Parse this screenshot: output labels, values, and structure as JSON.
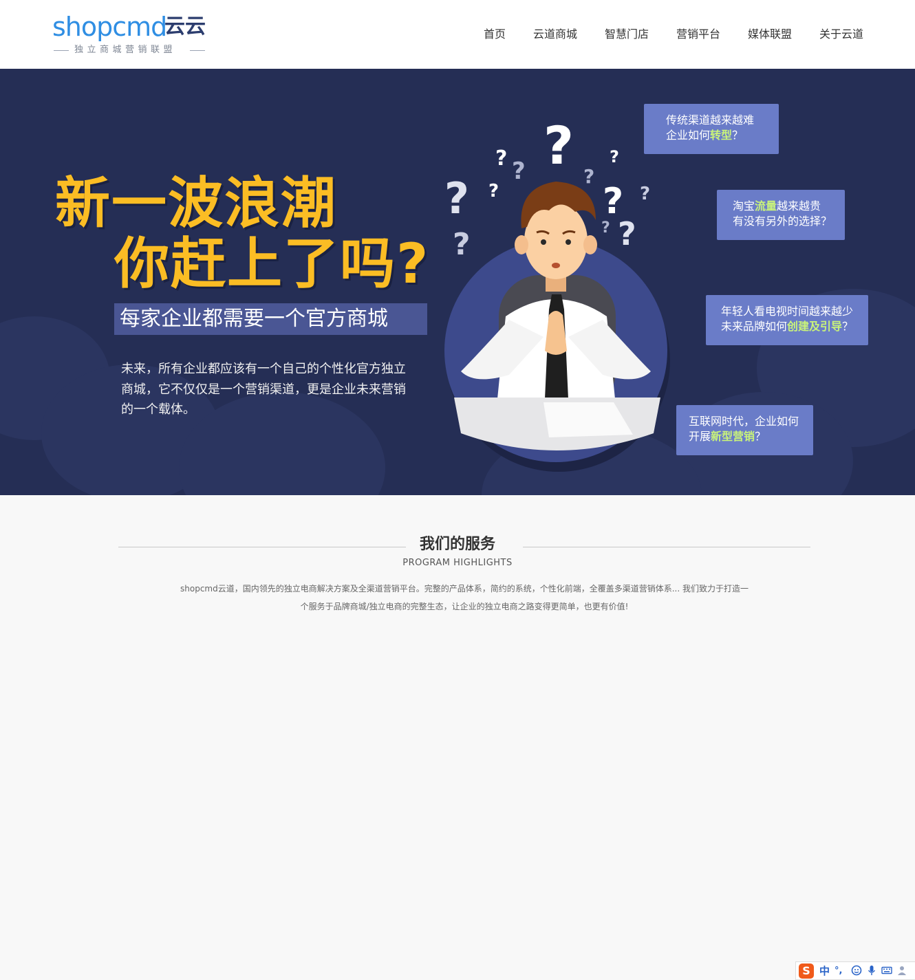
{
  "header": {
    "logo_text": "shopcmd",
    "logo_cn": "云云",
    "logo_tagline": "独立商城营销联盟",
    "nav": [
      {
        "label": "首页"
      },
      {
        "label": "云道商城"
      },
      {
        "label": "智慧门店"
      },
      {
        "label": "营销平台"
      },
      {
        "label": "媒体联盟"
      },
      {
        "label": "关于云道"
      }
    ]
  },
  "banner": {
    "headline_1": "新一波浪潮",
    "headline_2": "你赶上了吗?",
    "tagline": "每家企业都需要一个官方商城",
    "intro": "未来，所有企业都应该有一个自己的个性化官方独立商城，它不仅仅是一个营销渠道，更是企业未来营销的一个载体。",
    "bubbles": [
      {
        "line1": "传统渠道越来越难",
        "line2_pre": "企业如何",
        "line2_hl": "转型",
        "line2_post": "？"
      },
      {
        "line1_pre": "淘宝",
        "line1_hl": "流量",
        "line1_post": "越来越贵",
        "line2": "有没有另外的选择？"
      },
      {
        "line1": "年轻人看电视时间越来越少",
        "line2_pre": "未来品牌如何",
        "line2_hl": "创建及引导",
        "line2_post": "？"
      },
      {
        "line1": "互联网时代，企业如何",
        "line2_pre": "开展",
        "line2_hl": "新型营销",
        "line2_post": "？"
      }
    ],
    "colors": {
      "background": "#252e55",
      "headline": "#fbbd24",
      "bubble": "#6a7cc8",
      "highlight": "#c9f37a"
    }
  },
  "services": {
    "title": "我们的服务",
    "subtitle": "PROGRAM HIGHLIGHTS",
    "desc_line1": "shopcmd云道，国内领先的独立电商解决方案及全渠道营销平台。完整的产品体系，简约的系统，个性化前端，全覆盖多渠道营销体系... 我们致力于打造一",
    "desc_line2": "个服务于品牌商城/独立电商的完整生态，让企业的独立电商之路变得更简单，也更有价值!"
  },
  "ime_toolbar": {
    "logo": "S",
    "mode": "中",
    "punct": "°,",
    "icons": [
      "emoji-icon",
      "microphone-icon",
      "keyboard-icon",
      "user-icon"
    ]
  }
}
